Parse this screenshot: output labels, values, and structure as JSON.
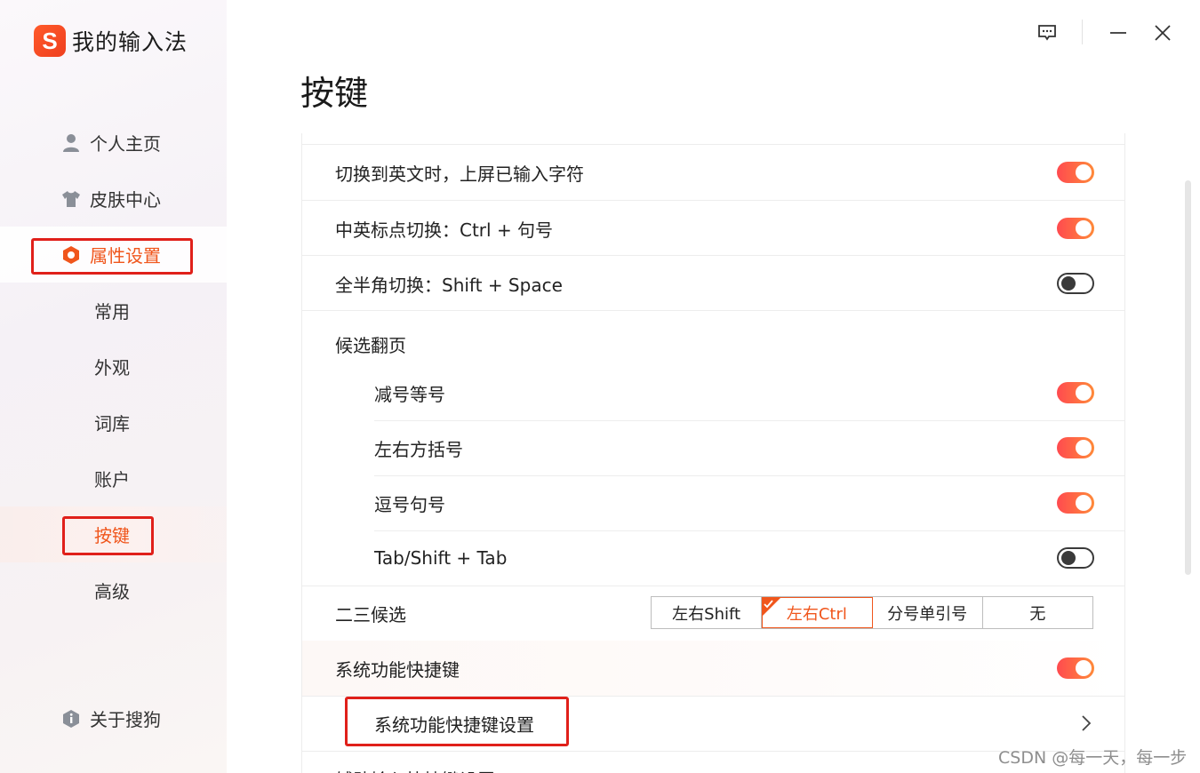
{
  "app": {
    "name": "我的输入法",
    "logo_glyph": "S",
    "accent_color": "#f0561c",
    "highlight_color": "#e0201a"
  },
  "titlebar": {
    "buttons": [
      "feedback-icon",
      "minimize-icon",
      "close-icon"
    ]
  },
  "sidebar": {
    "items": [
      {
        "label": "个人主页",
        "icon": "user-icon"
      },
      {
        "label": "皮肤中心",
        "icon": "shirt-icon"
      },
      {
        "label": "属性设置",
        "icon": "hexagon-settings-icon"
      },
      {
        "label": "常用"
      },
      {
        "label": "外观"
      },
      {
        "label": "词库"
      },
      {
        "label": "账户"
      },
      {
        "label": "按键"
      },
      {
        "label": "高级"
      }
    ],
    "footer": {
      "label": "关于搜狗",
      "icon": "info-shield-icon"
    }
  },
  "main": {
    "title": "按键",
    "rows": [
      {
        "label": "切换到英文时，上屏已输入字符",
        "toggle": true
      },
      {
        "label": "中英标点切换：Ctrl + 句号",
        "toggle": true
      },
      {
        "label": "全半角切换：Shift + Space",
        "toggle": false
      },
      {
        "label": "候选翻页"
      },
      {
        "label": "减号等号",
        "toggle": true
      },
      {
        "label": "左右方括号",
        "toggle": true
      },
      {
        "label": "逗号句号",
        "toggle": true
      },
      {
        "label": "Tab/Shift + Tab",
        "toggle": false
      },
      {
        "label": "二三候选"
      },
      {
        "label": "系统功能快捷键",
        "toggle": true
      },
      {
        "label": "系统功能快捷键设置"
      },
      {
        "label": "辅助输入快捷键设置"
      }
    ],
    "second_third_candidate": {
      "options": [
        "左右Shift",
        "左右Ctrl",
        "分号单引号",
        "无"
      ],
      "selected": "左右Ctrl"
    }
  },
  "watermark": "CSDN @每一天，每一步"
}
